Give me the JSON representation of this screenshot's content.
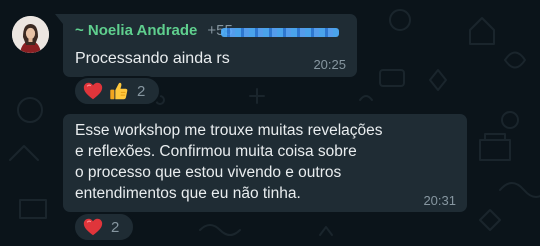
{
  "messages": [
    {
      "sender_name": "~ Noelia Andrade",
      "sender_phone": "+55",
      "text": "Processando ainda rs",
      "time": "20:25",
      "reactions": {
        "emojis": [
          "red-heart-icon",
          "thumbs-up-icon"
        ],
        "count": "2"
      }
    },
    {
      "text_lines": [
        "Esse workshop me trouxe muitas revelações",
        "e reflexões. Confirmou muita coisa sobre",
        "o processo que estou vivendo e outros",
        "entendimentos que eu não tinha."
      ],
      "time": "20:31",
      "reactions": {
        "emojis": [
          "red-heart-icon"
        ],
        "count": "2"
      }
    }
  ],
  "colors": {
    "background": "#0b141a",
    "bubble": "#1f2c34",
    "sender_name": "#5fcf8e",
    "meta_text": "#8696a0",
    "message_text": "#e9edef"
  }
}
